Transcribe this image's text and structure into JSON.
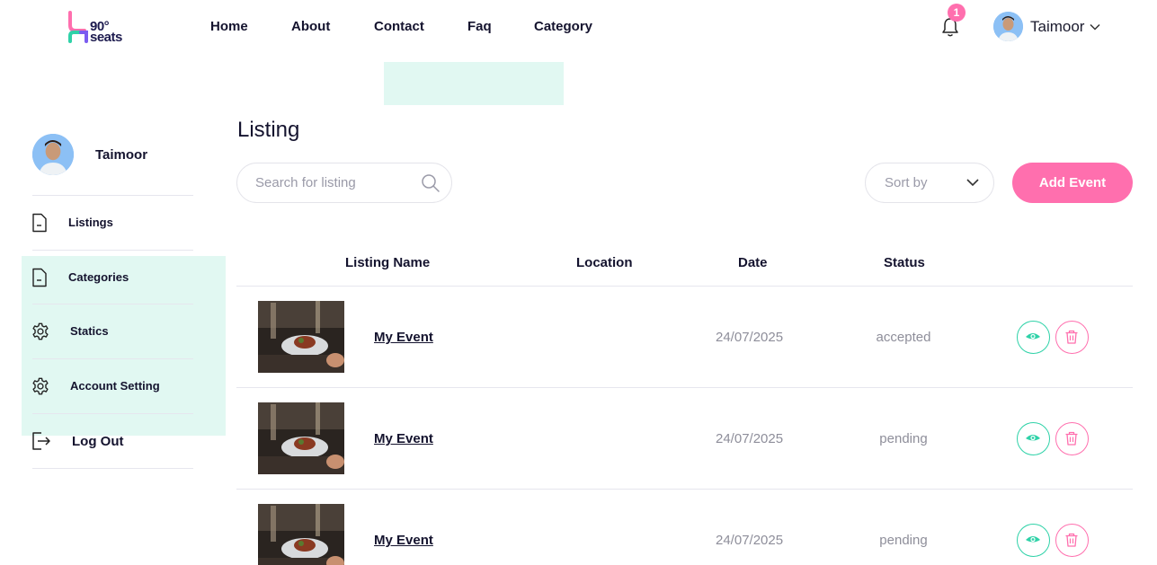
{
  "brand": {
    "logo_line1": "90°",
    "logo_line2": "seats"
  },
  "nav": [
    "Home",
    "About",
    "Contact",
    "Faq",
    "Category"
  ],
  "notifications": {
    "count": "1",
    "icon": "bell-icon"
  },
  "user": {
    "name": "Taimoor"
  },
  "sidebar": {
    "name": "Taimoor",
    "items": [
      {
        "label": "Listings",
        "icon": "document-icon"
      },
      {
        "label": "Categories",
        "icon": "document-icon"
      },
      {
        "label": "Statics",
        "icon": "gear-icon"
      },
      {
        "label": "Account Setting",
        "icon": "gear-icon"
      },
      {
        "label": "Log Out",
        "icon": "logout-icon"
      }
    ]
  },
  "main": {
    "title": "Listing",
    "search_placeholder": "Search for listing",
    "sort_label": "Sort by",
    "add_button": "Add Event",
    "columns": [
      "Listing Name",
      "Location",
      "Date",
      "Status"
    ],
    "rows": [
      {
        "name": "My Event",
        "location": "",
        "date": "24/07/2025",
        "status": "accepted"
      },
      {
        "name": "My Event",
        "location": "",
        "date": "24/07/2025",
        "status": "pending"
      },
      {
        "name": "My Event",
        "location": "",
        "date": "24/07/2025",
        "status": "pending"
      }
    ]
  },
  "colors": {
    "accent": "#ff6fae",
    "mint": "#2fd2a8",
    "panel": "#e1f8f2",
    "text": "#14132e"
  }
}
